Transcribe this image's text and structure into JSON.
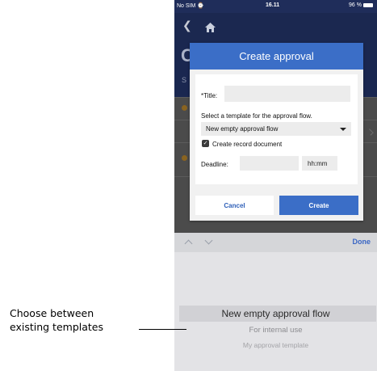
{
  "status_bar": {
    "carrier": "No SIM",
    "time": "16.11",
    "battery": "96 %"
  },
  "background": {
    "title_letter": "C",
    "subtitle_letter": "S"
  },
  "dialog": {
    "header": "Create approval",
    "title_label": "*Title:",
    "title_value": "",
    "template_prompt": "Select a template for the approval flow.",
    "template_selected": "New empty approval flow",
    "record_checkbox_label": "Create record document",
    "record_checked": true,
    "deadline_label": "Deadline:",
    "deadline_date": "",
    "deadline_time_placeholder": "hh:mm",
    "cancel_label": "Cancel",
    "create_label": "Create"
  },
  "picker": {
    "done_label": "Done",
    "options": [
      "New empty approval flow",
      "For internal use",
      "My approval template"
    ]
  },
  "annotation": {
    "line1": "Choose between",
    "line2": "existing templates"
  },
  "colors": {
    "accent": "#3b6ec7",
    "nav_dark": "#1b2850",
    "link_blue": "#3a66c4"
  }
}
